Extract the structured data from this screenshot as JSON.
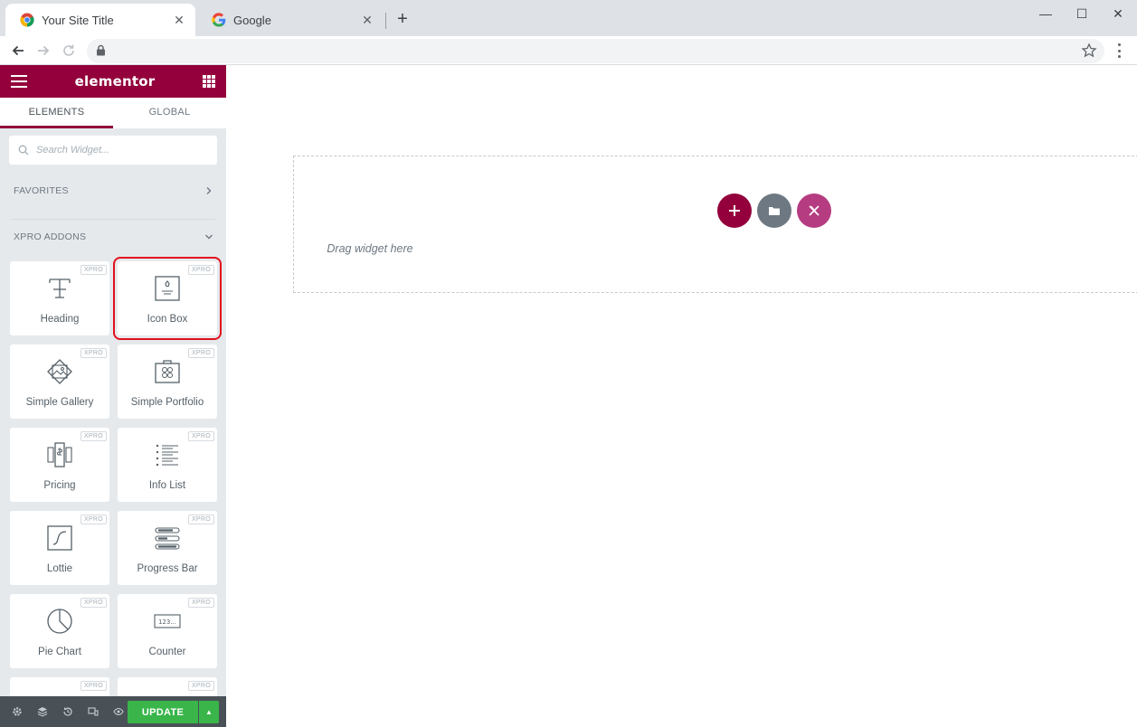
{
  "browser": {
    "tabs": [
      {
        "title": "Your Site Title",
        "active": true,
        "favicon": "chrome-icon"
      },
      {
        "title": "Google",
        "active": false,
        "favicon": "google-icon"
      }
    ],
    "new_tab_label": "+",
    "window_controls": {
      "minimize": "—",
      "maximize": "☐",
      "close": "✕"
    },
    "address": ""
  },
  "panel": {
    "logo": "elementor",
    "tabs": [
      "ELEMENTS",
      "GLOBAL"
    ],
    "active_tab": "ELEMENTS",
    "search_placeholder": "Search Widget...",
    "categories": {
      "favorites": "FAVORITES",
      "xpro": "XPRO ADDONS"
    },
    "badge": "XPRO",
    "widgets": [
      {
        "label": "Heading",
        "icon": "heading-icon"
      },
      {
        "label": "Icon Box",
        "icon": "icon-box-icon",
        "highlighted": true
      },
      {
        "label": "Simple Gallery",
        "icon": "gallery-icon"
      },
      {
        "label": "Simple Portfolio",
        "icon": "portfolio-icon"
      },
      {
        "label": "Pricing",
        "icon": "pricing-icon"
      },
      {
        "label": "Info List",
        "icon": "info-list-icon"
      },
      {
        "label": "Lottie",
        "icon": "lottie-icon"
      },
      {
        "label": "Progress Bar",
        "icon": "progress-bar-icon"
      },
      {
        "label": "Pie Chart",
        "icon": "pie-chart-icon"
      },
      {
        "label": "Counter",
        "icon": "counter-icon"
      }
    ],
    "footer": {
      "update_label": "UPDATE",
      "icons": [
        "settings-icon",
        "layers-icon",
        "history-icon",
        "responsive-icon",
        "preview-icon"
      ]
    },
    "colors": {
      "brand": "#93003c",
      "update": "#39b54a",
      "highlight": "#e2101d"
    }
  },
  "canvas": {
    "drop_text": "Drag widget here",
    "counter_icon_text": "123..."
  }
}
